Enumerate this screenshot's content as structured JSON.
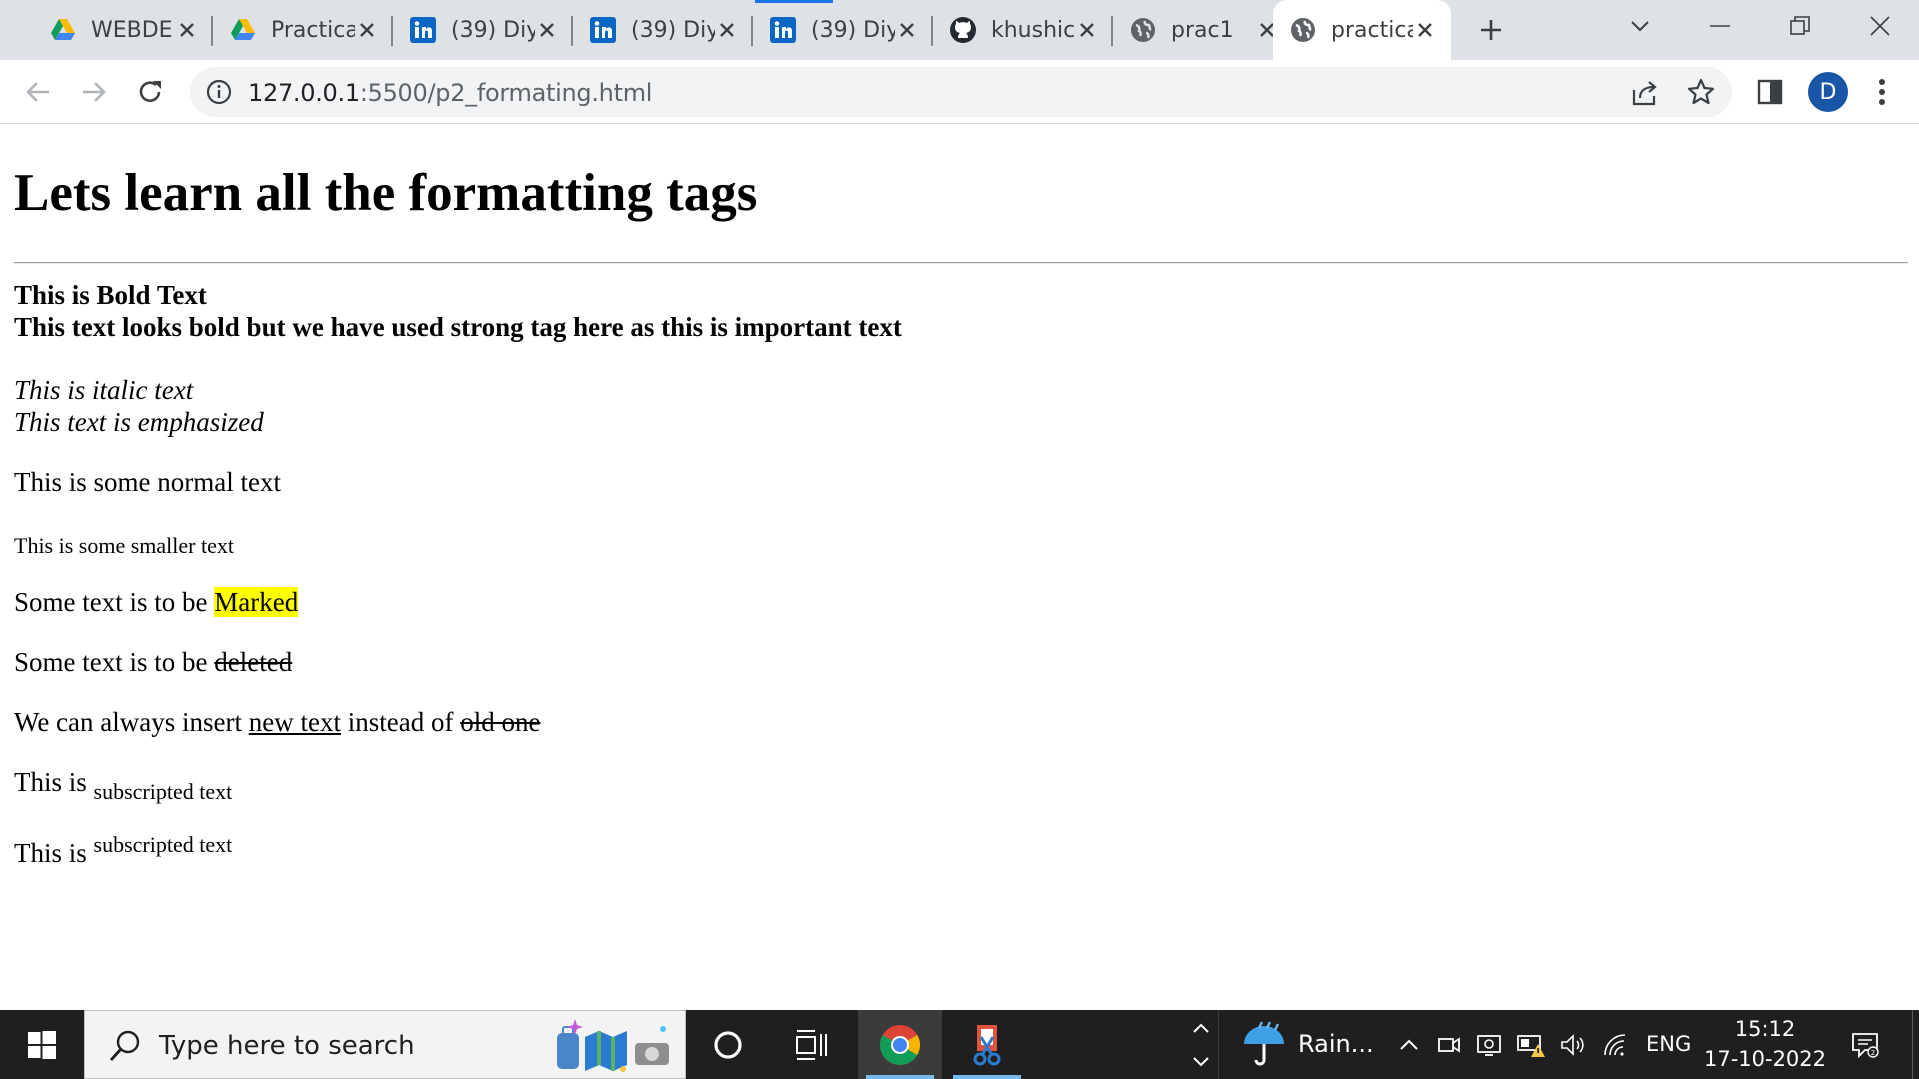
{
  "browser": {
    "tabs": [
      {
        "title": "WEBDE",
        "icon": "google-drive-icon"
      },
      {
        "title": "Practica",
        "icon": "google-drive-icon"
      },
      {
        "title": "(39) Diy",
        "icon": "linkedin-icon"
      },
      {
        "title": "(39) Diy",
        "icon": "linkedin-icon"
      },
      {
        "title": "(39) Diy",
        "icon": "linkedin-icon"
      },
      {
        "title": "khushic",
        "icon": "github-icon"
      },
      {
        "title": "prac1",
        "icon": "globe-icon"
      },
      {
        "title": "practica",
        "icon": "globe-icon",
        "active": true
      }
    ],
    "address": {
      "host": "127.0.0.1",
      "path": ":5500/p2_formating.html"
    },
    "profile_initial": "D",
    "accent_color": "#1a73e8"
  },
  "page": {
    "heading": "Lets learn all the formatting tags",
    "bold": "This is Bold Text",
    "strong": "This text looks bold but we have used strong tag here as this is important text",
    "italic": "This is italic text",
    "emphasized": "This text is emphasized",
    "normal": "This is some normal text",
    "smaller": "This is some smaller text",
    "marked_prefix": "Some text is to be ",
    "marked_word": "Marked",
    "deleted_prefix": "Some text is to be ",
    "deleted_word": "deleted",
    "insert_prefix": "We can always insert ",
    "insert_new": "new text",
    "insert_middle": " instead of ",
    "insert_old": "old one",
    "sub_prefix": "This is ",
    "sub_text": "subscripted text",
    "sup_prefix": "This is ",
    "sup_text": "subscripted text",
    "highlight_color": "#ffff00"
  },
  "taskbar": {
    "search_placeholder": "Type here to search",
    "weather": "Rain...",
    "language": "ENG",
    "time": "15:12",
    "date": "17-10-2022"
  }
}
